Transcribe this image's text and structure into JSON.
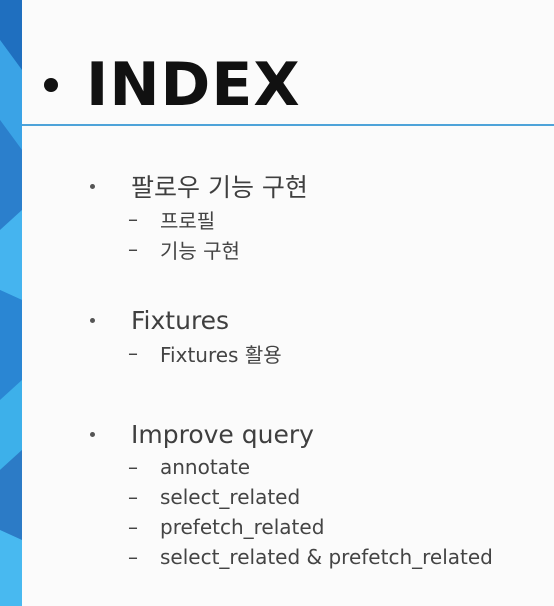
{
  "slide": {
    "title": "INDEX",
    "accent_color": "#4ea3d9",
    "sections": [
      {
        "title": "팔로우 기능 구현",
        "items": [
          "프로필",
          "기능 구현"
        ]
      },
      {
        "title": "Fixtures",
        "items": [
          "Fixtures 활용"
        ]
      },
      {
        "title": "Improve query",
        "items": [
          "annotate",
          "select_related",
          "prefetch_related",
          "select_related & prefetch_related"
        ]
      }
    ],
    "dash_glyph": "–"
  }
}
